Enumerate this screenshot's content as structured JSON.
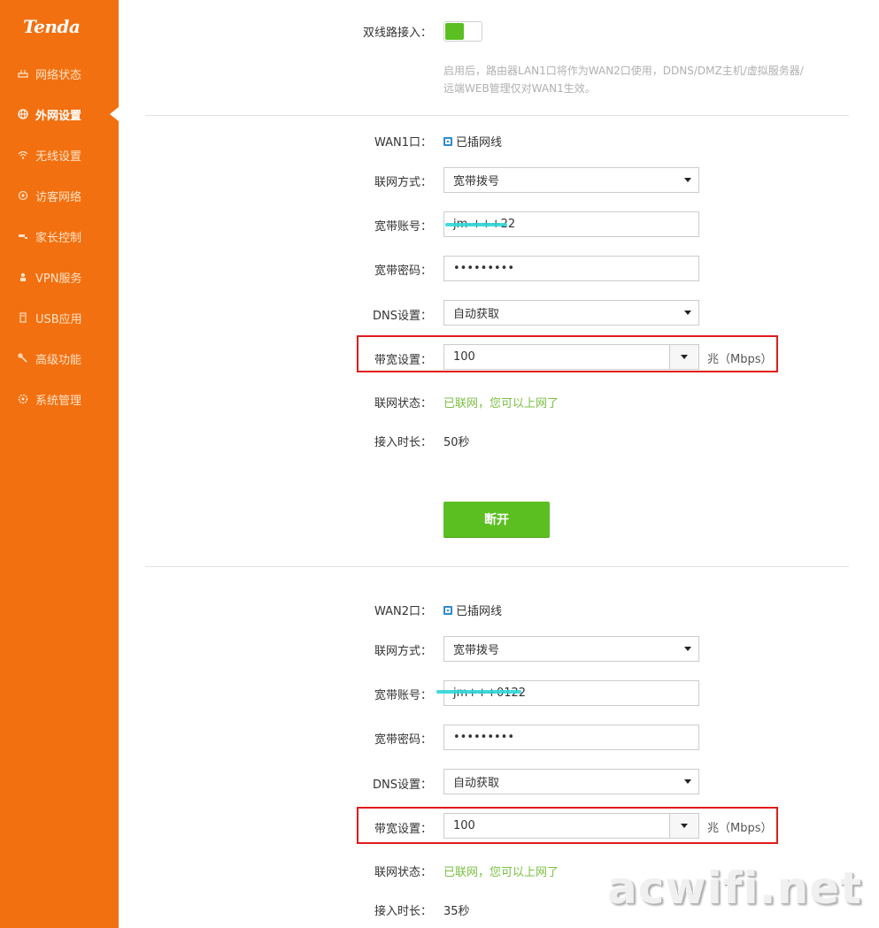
{
  "app": {
    "logo_text": "Tenda"
  },
  "sidebar": {
    "items": [
      {
        "label": "网络状态",
        "icon": "router-icon"
      },
      {
        "label": "外网设置",
        "icon": "globe-icon",
        "active": true
      },
      {
        "label": "无线设置",
        "icon": "wifi-icon"
      },
      {
        "label": "访客网络",
        "icon": "guest-icon"
      },
      {
        "label": "家长控制",
        "icon": "parental-icon"
      },
      {
        "label": "VPN服务",
        "icon": "vpn-icon"
      },
      {
        "label": "USB应用",
        "icon": "usb-icon"
      },
      {
        "label": "高级功能",
        "icon": "wrench-icon"
      },
      {
        "label": "系统管理",
        "icon": "gear-icon"
      }
    ]
  },
  "dual_wan": {
    "label": "双线路接入：",
    "enabled": true,
    "hint_line1": "启用后，路由器LAN1口将作为WAN2口使用，DDNS/DMZ主机/虚拟服务器/",
    "hint_line2": "远端WEB管理仅对WAN1生效。"
  },
  "wan1": {
    "port_label": "WAN1口：",
    "cable_status": "已插网线",
    "mode_label": "联网方式：",
    "mode_value": "宽带拨号",
    "account_label": "宽带账号：",
    "account_value": "jm-+++22",
    "password_label": "宽带密码：",
    "password_value": "•••••••••",
    "dns_label": "DNS设置：",
    "dns_value": "自动获取",
    "bandwidth_label": "带宽设置：",
    "bandwidth_value": "100",
    "bandwidth_unit": "兆（Mbps）",
    "status_label": "联网状态：",
    "status_value": "已联网，您可以上网了",
    "uptime_label": "接入时长：",
    "uptime_value": "50秒",
    "disconnect_label": "断开"
  },
  "wan2": {
    "port_label": "WAN2口：",
    "cable_status": "已插网线",
    "mode_label": "联网方式：",
    "mode_value": "宽带拨号",
    "account_label": "宽带账号：",
    "account_value": "jm+++0122",
    "password_label": "宽带密码：",
    "password_value": "•••••••••",
    "dns_label": "DNS设置：",
    "dns_value": "自动获取",
    "bandwidth_label": "带宽设置：",
    "bandwidth_value": "100",
    "bandwidth_unit": "兆（Mbps）",
    "status_label": "联网状态：",
    "status_value": "已联网，您可以上网了",
    "uptime_label": "接入时长：",
    "uptime_value": "35秒"
  },
  "watermark": "acwifi.net",
  "colors": {
    "sidebar_bg": "#f27010",
    "accent_green": "#5bbf21",
    "status_green": "#7bc043",
    "highlight_red": "#e01b1b"
  }
}
